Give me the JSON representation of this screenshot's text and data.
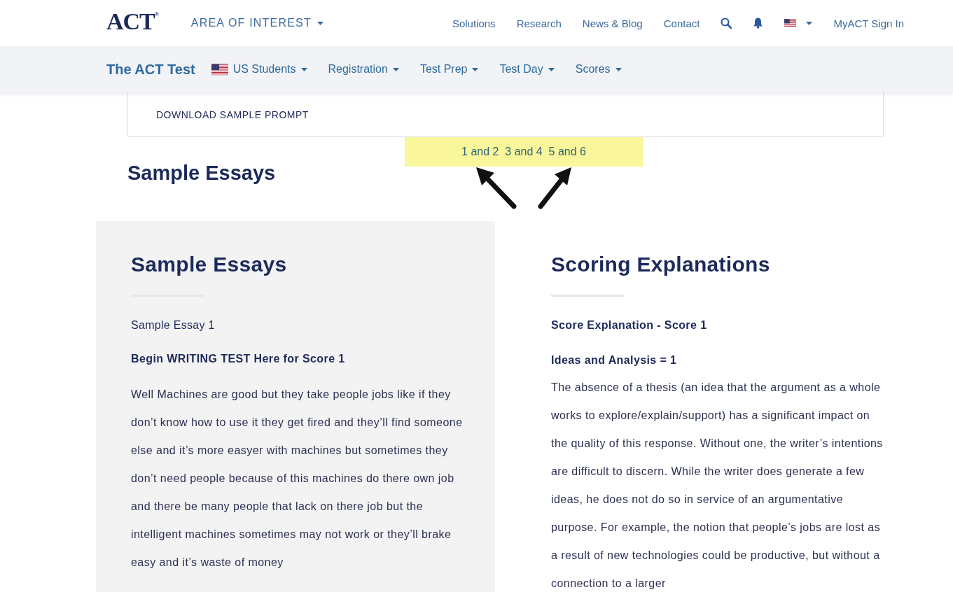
{
  "header": {
    "logo": "ACT",
    "logo_mark": "®",
    "area_menu": "AREA OF INTEREST",
    "links": [
      "Solutions",
      "Research",
      "News & Blog",
      "Contact"
    ],
    "sign_in": "MyACT Sign In"
  },
  "subnav": {
    "title": "The ACT Test",
    "items": [
      {
        "label": "US Students",
        "kind": "flag"
      },
      {
        "label": "Registration",
        "kind": "menu"
      },
      {
        "label": "Test Prep",
        "kind": "menu"
      },
      {
        "label": "Test Day",
        "kind": "menu"
      },
      {
        "label": "Scores",
        "kind": "menu"
      }
    ]
  },
  "prompt_link": "DOWNLOAD SAMPLE PROMPT",
  "highlight": "1 and 2  3 and 4  5 and 6",
  "page_heading": "Sample Essays",
  "essay_panel": {
    "title": "Sample Essays",
    "label": "Sample Essay 1",
    "heading": "Begin WRITING TEST Here for Score 1",
    "body": "Well Machines are good but they take people jobs like if they don’t know how to use it they get fired and they’ll find someone else and it’s more easyer with machines but sometimes they don’t need people because of this machines do there own job and there be many people that lack on there job but the intelligent machines sometimes may not work or they’ll brake easy and it’s waste of money"
  },
  "scoring_panel": {
    "title": "Scoring Explanations",
    "subtitle": "Score Explanation - Score 1",
    "heading": "Ideas and Analysis = 1",
    "body": "The absence of a thesis (an idea that the argument as a whole works to explore/explain/support) has a significant impact on the quality of this response. Without one, the writer’s intentions are difficult to discern. While the writer does generate a few ideas, he does not do so in service of an argumentative purpose. For example, the notion that people’s jobs are lost as a result of new technologies could be productive, but without a connection to a larger"
  }
}
